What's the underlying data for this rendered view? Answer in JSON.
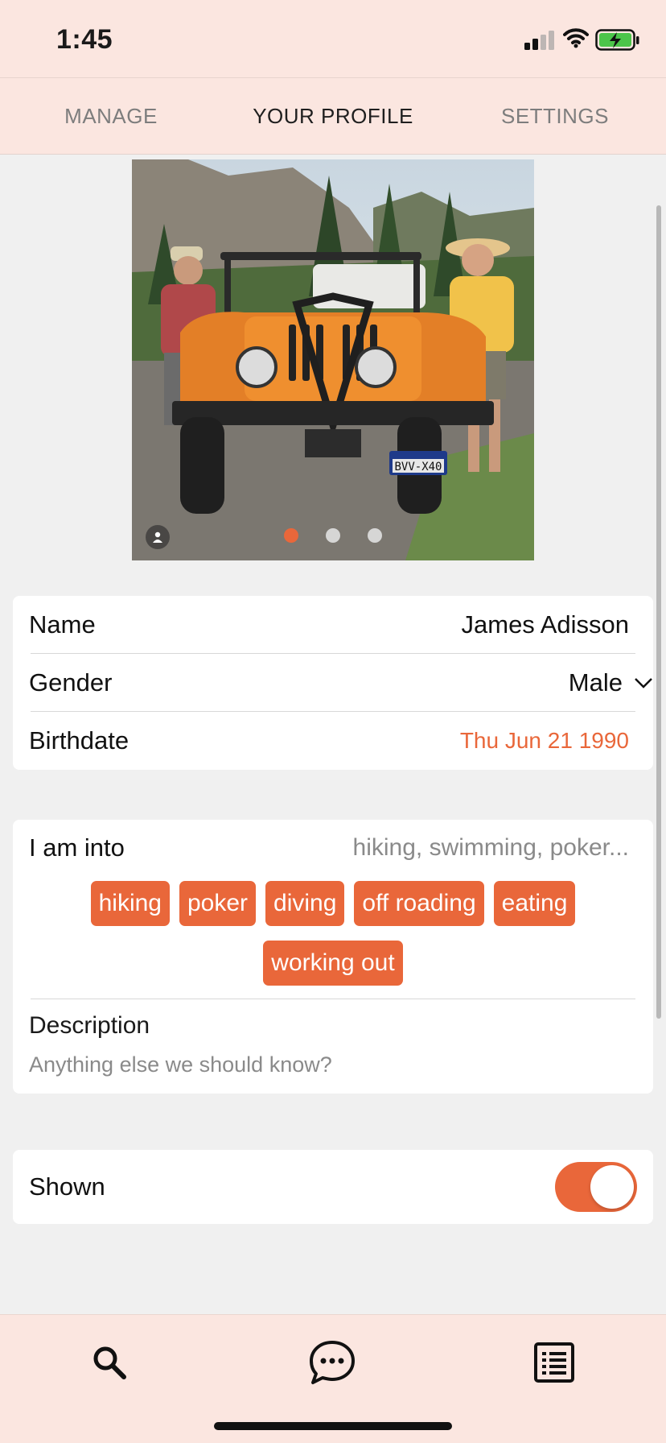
{
  "status_bar": {
    "time": "1:45"
  },
  "top_tabs": [
    {
      "label": "MANAGE",
      "active": false
    },
    {
      "label": "YOUR PROFILE",
      "active": true
    },
    {
      "label": "SETTINGS",
      "active": false
    }
  ],
  "photo_carousel": {
    "page_count": 3,
    "current_page": 1,
    "plate_text": "BVV-X40"
  },
  "profile": {
    "name_label": "Name",
    "name_value": "James Adisson",
    "gender_label": "Gender",
    "gender_value": "Male",
    "birthdate_label": "Birthdate",
    "birthdate_value": "Thu Jun 21 1990"
  },
  "interests": {
    "label": "I am into",
    "placeholder": "hiking, swimming, poker...",
    "tags": [
      "hiking",
      "poker",
      "diving",
      "off roading",
      "eating",
      "working out"
    ]
  },
  "description": {
    "label": "Description",
    "placeholder": "Anything else we should know?"
  },
  "visibility": {
    "label": "Shown",
    "on": true
  },
  "bottom_nav": {
    "icons": [
      "search-icon",
      "chat-icon",
      "list-icon"
    ]
  },
  "colors": {
    "accent": "#e9673a",
    "bar_background": "#fbe6e0",
    "page_background": "#f0f0f0"
  }
}
